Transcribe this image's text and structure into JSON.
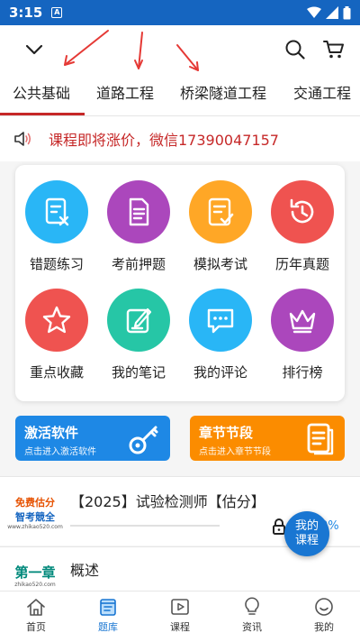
{
  "status": {
    "time": "3:15",
    "notif_glyph": "A"
  },
  "tabs": [
    {
      "label": "公共基础",
      "active": true
    },
    {
      "label": "道路工程",
      "active": false
    },
    {
      "label": "桥梁隧道工程",
      "active": false
    },
    {
      "label": "交通工程",
      "active": false
    }
  ],
  "notice": {
    "text": "课程即将涨价，微信17390047157"
  },
  "features": [
    {
      "label": "错题练习",
      "color": "#29b6f6",
      "icon": "wrong-question-icon"
    },
    {
      "label": "考前押题",
      "color": "#ab47bc",
      "icon": "document-icon"
    },
    {
      "label": "模拟考试",
      "color": "#ffa726",
      "icon": "checklist-icon"
    },
    {
      "label": "历年真题",
      "color": "#ef5350",
      "icon": "history-icon"
    },
    {
      "label": "重点收藏",
      "color": "#ef5350",
      "icon": "star-icon"
    },
    {
      "label": "我的笔记",
      "color": "#26c6a6",
      "icon": "note-icon"
    },
    {
      "label": "我的评论",
      "color": "#29b6f6",
      "icon": "comment-icon"
    },
    {
      "label": "排行榜",
      "color": "#ab47bc",
      "icon": "crown-icon"
    }
  ],
  "banners": {
    "activate": {
      "title": "激活软件",
      "subtitle": "点击进入激活软件",
      "color": "#1e88e5",
      "icon": "key-icon"
    },
    "chapter": {
      "title": "章节节段",
      "subtitle": "点击进入章节节段",
      "color": "#fb8c00",
      "icon": "document-icon"
    }
  },
  "courses": [
    {
      "title": "【2025】试验检测师【估分】",
      "thumb_line1": "免费估分",
      "thumb_line2": "智考競全",
      "thumb_line3": "www.zhikao520.com",
      "progress": "0%"
    },
    {
      "title": "概述",
      "thumb_line1": "第一章",
      "thumb_line3": "zhikao520.com"
    }
  ],
  "fab": {
    "line1": "我的",
    "line2": "课程"
  },
  "nav": [
    {
      "label": "首页",
      "icon": "home-icon",
      "active": false
    },
    {
      "label": "题库",
      "icon": "question-bank-icon",
      "active": true
    },
    {
      "label": "课程",
      "icon": "play-icon",
      "active": false
    },
    {
      "label": "资讯",
      "icon": "bulb-icon",
      "active": false
    },
    {
      "label": "我的",
      "icon": "smile-icon",
      "active": false
    }
  ]
}
